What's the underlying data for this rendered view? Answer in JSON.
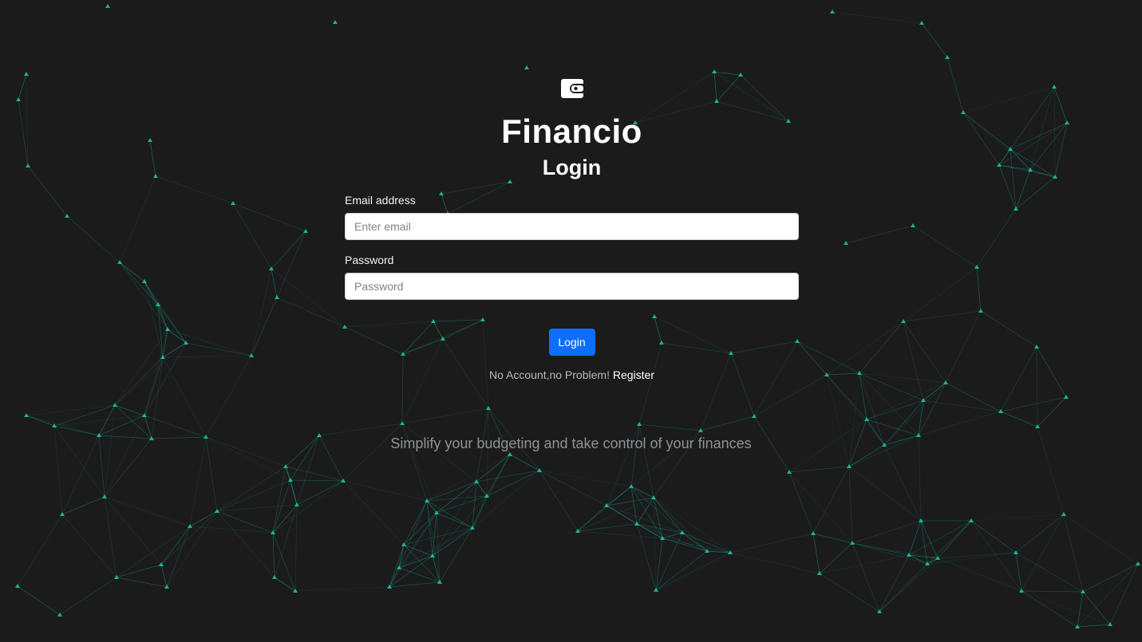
{
  "app": {
    "title": "Financio",
    "logo_icon": "wallet-icon"
  },
  "login_form": {
    "heading": "Login",
    "email_label": "Email address",
    "email_placeholder": "Enter email",
    "email_value": "",
    "password_label": "Password",
    "password_placeholder": "Password",
    "password_value": "",
    "submit_label": "Login"
  },
  "register_prompt": {
    "text": "No Account,no Problem!",
    "link_label": "Register"
  },
  "tagline": "Simplify your budgeting and take control of your finances",
  "theme": {
    "background": "#1b1b1c",
    "network_color": "#1ec8a5",
    "button_color": "#0d6efd"
  }
}
